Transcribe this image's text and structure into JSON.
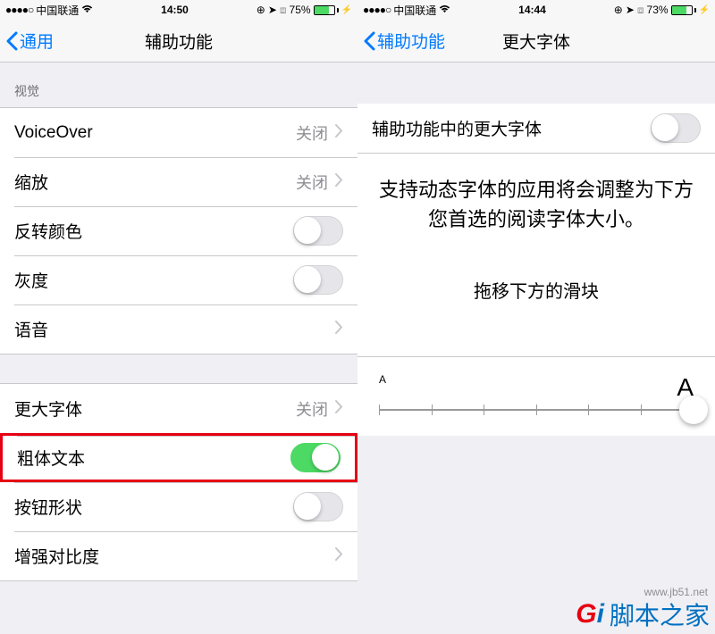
{
  "left": {
    "status": {
      "carrier": "中国联通",
      "time": "14:50",
      "battery_pct": "75%",
      "signal": "●●●●○"
    },
    "nav": {
      "back": "通用",
      "title": "辅助功能"
    },
    "section_vision": "视觉",
    "voiceover": {
      "label": "VoiceOver",
      "value": "关闭"
    },
    "zoom": {
      "label": "缩放",
      "value": "关闭"
    },
    "invert": {
      "label": "反转颜色"
    },
    "grayscale": {
      "label": "灰度"
    },
    "speech": {
      "label": "语音"
    },
    "larger_text": {
      "label": "更大字体",
      "value": "关闭"
    },
    "bold_text": {
      "label": "粗体文本"
    },
    "button_shapes": {
      "label": "按钮形状"
    },
    "increase_contrast": {
      "label": "增强对比度"
    }
  },
  "right": {
    "status": {
      "carrier": "中国联通",
      "time": "14:44",
      "battery_pct": "73%",
      "signal": "●●●●○"
    },
    "nav": {
      "back": "辅助功能",
      "title": "更大字体"
    },
    "toggle_label": "辅助功能中的更大字体",
    "description": "支持动态字体的应用将会调整为下方您首选的阅读字体大小。",
    "slider_hint": "拖移下方的滑块",
    "a_small": "A",
    "a_large": "A"
  },
  "watermark": {
    "url": "www.jb51.net",
    "text": "脚本之家"
  }
}
